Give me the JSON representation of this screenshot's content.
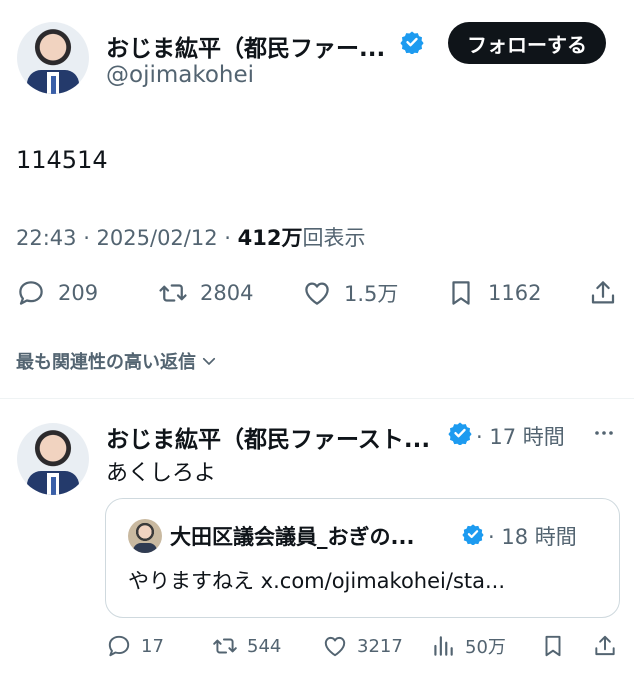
{
  "main_tweet": {
    "author_name": "おじま紘平（都民ファー...",
    "handle": "@ojimakohei",
    "follow_label": "フォローする",
    "text": "114514",
    "time": "22:43 · 2025/02/12 · ",
    "views_count": "412万",
    "views_label": "回表示",
    "actions": {
      "replies": "209",
      "retweets": "2804",
      "likes": "1.5万",
      "bookmarks": "1162"
    }
  },
  "relevant_replies_label": "最も関連性の高い返信",
  "reply": {
    "author_name": "おじま紘平（都民ファースト...",
    "time": "· 17 時間",
    "text": "あくしろよ",
    "quote": {
      "author_name": "大田区議会議員_おぎの...",
      "time": "· 18 時間",
      "text": "やりますねえ x.com/ojimakohei/sta..."
    },
    "actions": {
      "replies": "17",
      "retweets": "544",
      "likes": "3217",
      "views": "50万"
    }
  },
  "colors": {
    "verified": "#1d9bf0",
    "text_primary": "#0f1419",
    "text_secondary": "#536471",
    "follow_bg": "#0f1419"
  }
}
